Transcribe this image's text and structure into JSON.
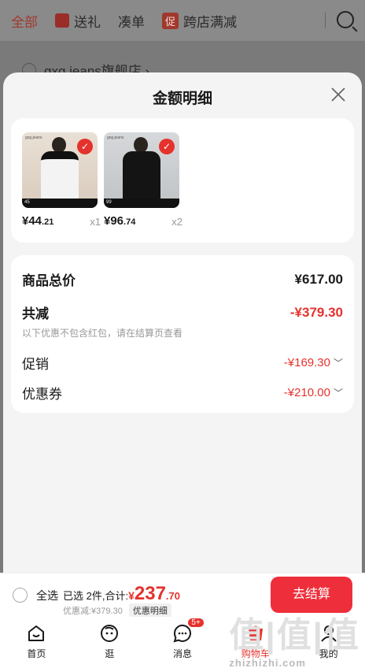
{
  "background": {
    "tabs": [
      {
        "label": "全部"
      },
      {
        "label": "送礼"
      },
      {
        "label": "凑单"
      },
      {
        "tag": "促",
        "label": "跨店满减"
      }
    ],
    "store_name": "gxg.jeans旗舰店 ›"
  },
  "sheet": {
    "title": "金额明细",
    "products": [
      {
        "brand": "gxg.jeans",
        "strip": "45",
        "price_int": "¥44",
        "price_dec": ".21",
        "qty": "x1"
      },
      {
        "brand": "gxg.jeans",
        "strip": "99",
        "price_int": "¥96",
        "price_dec": ".74",
        "qty": "x2"
      }
    ],
    "summary": {
      "total_label": "商品总价",
      "total_value": "¥617.00",
      "reduce_label": "共减",
      "reduce_value": "-¥379.30",
      "note": "以下优惠不包含红包，请在结算页查看",
      "promo_label": "促销",
      "promo_value": "-¥169.30",
      "coupon_label": "优惠券",
      "coupon_value": "-¥210.00"
    }
  },
  "checkout": {
    "select_all": "全选",
    "selected": "已选 2件,合计:",
    "currency": "¥",
    "total_int": "237",
    "total_dec": ".70",
    "discount": "优惠减:¥379.30",
    "detail_button": "优惠明细",
    "pay_button": "去结算"
  },
  "nav": {
    "items": [
      {
        "label": "首页"
      },
      {
        "label": "逛"
      },
      {
        "label": "消息",
        "badge": "5+"
      },
      {
        "label": "购物车"
      },
      {
        "label": "我的"
      }
    ]
  },
  "watermark": {
    "big": "值|值|值",
    "small": "zhizhizhi.com"
  },
  "colors": {
    "accent": "#e5322d",
    "button": "#ee2f3b"
  }
}
